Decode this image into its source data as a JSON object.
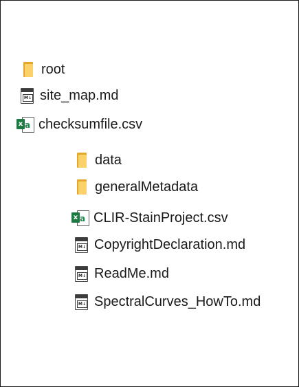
{
  "top_level": [
    {
      "label": "root",
      "icon": "folder-icon"
    },
    {
      "label": "site_map.md",
      "icon": "markdown-file-icon",
      "icon_text": "M↓"
    },
    {
      "label": "checksumfile.csv",
      "icon": "excel-file-icon",
      "icon_text": "x",
      "icon_text_2": "a"
    }
  ],
  "nested": [
    {
      "label": "data",
      "icon": "folder-icon"
    },
    {
      "label": "generalMetadata",
      "icon": "folder-icon"
    },
    {
      "label": "CLIR-StainProject.csv",
      "icon": "excel-file-icon",
      "icon_text": "x",
      "icon_text_2": "a"
    },
    {
      "label": "CopyrightDeclaration.md",
      "icon": "markdown-file-icon",
      "icon_text": "M↓"
    },
    {
      "label": "ReadMe.md",
      "icon": "markdown-file-icon",
      "icon_text": "M↓"
    },
    {
      "label": "SpectralCurves_HowTo.md",
      "icon": "markdown-file-icon",
      "icon_text": "M↓"
    }
  ],
  "colors": {
    "folder_front": "#fcd169",
    "folder_back": "#e3a82a",
    "excel_green": "#1d7a43",
    "text": "#1a1a1a",
    "frame_border": "#1a1a1a"
  }
}
